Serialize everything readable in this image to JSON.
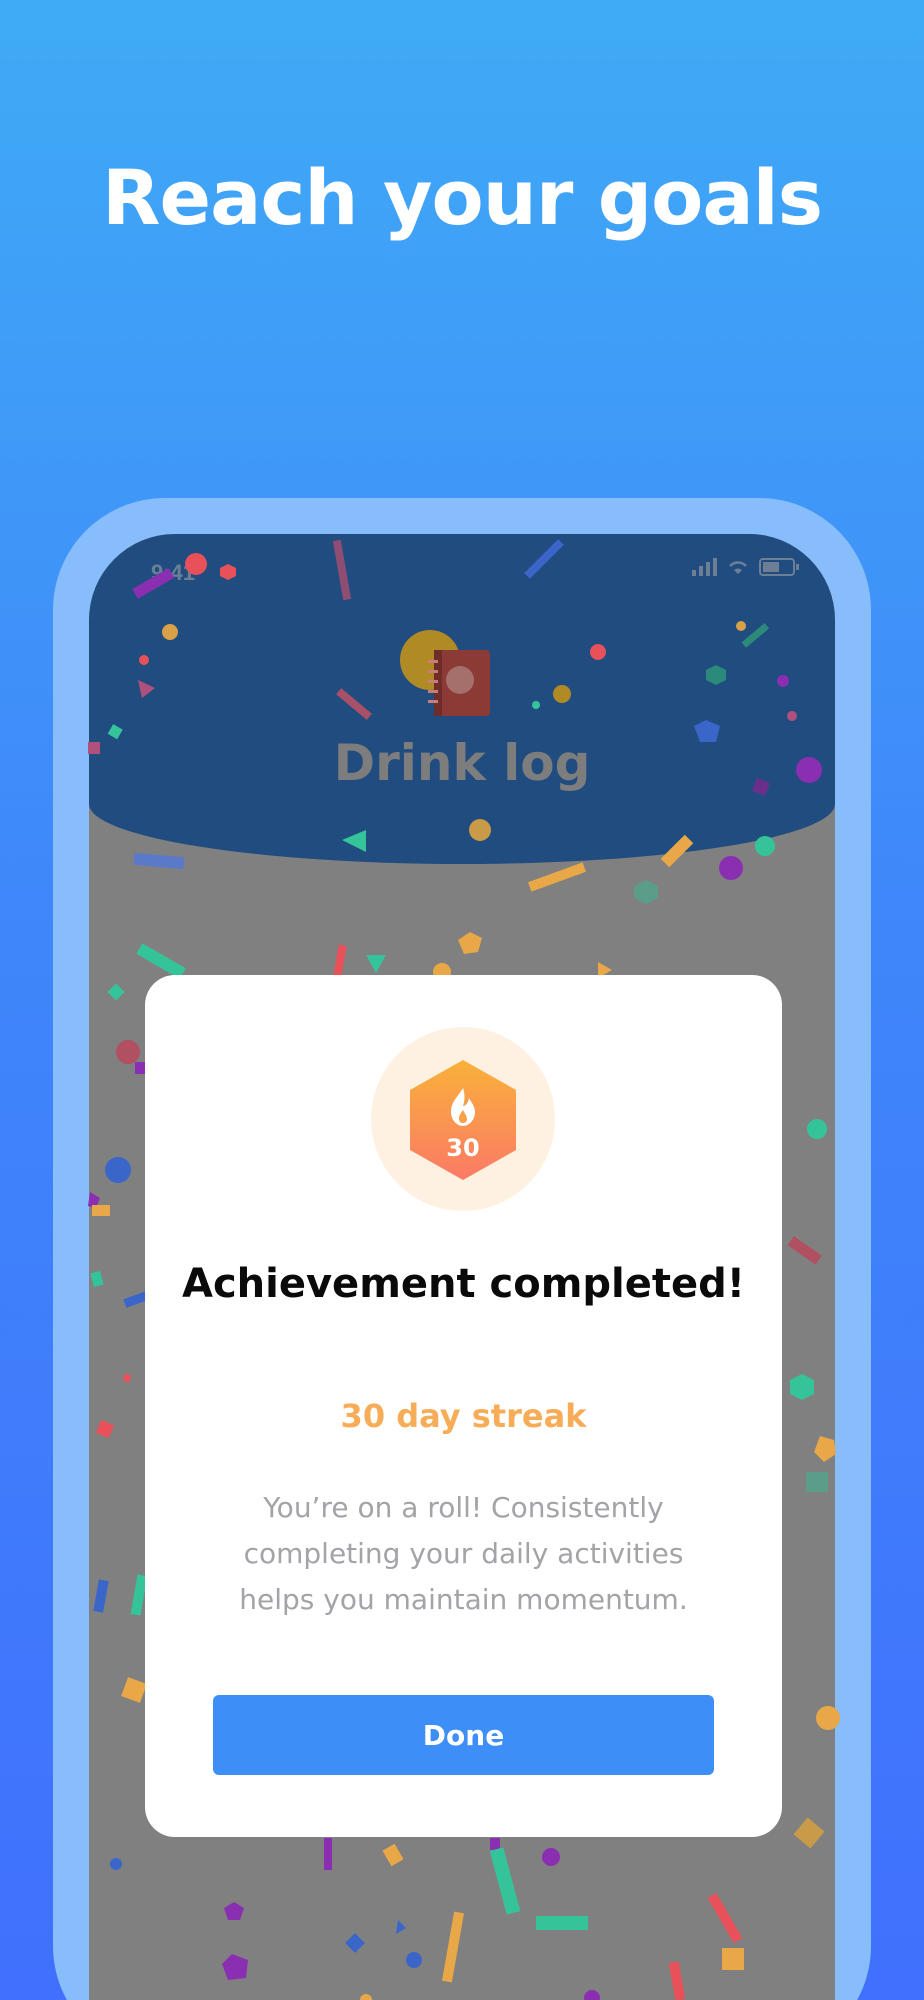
{
  "headline": "Reach your goals",
  "status_bar": {
    "time": "9:41"
  },
  "app": {
    "title": "Drink log"
  },
  "achievement": {
    "badge_number": "30",
    "badge_icon": "flame-icon",
    "title": "Achievement completed!",
    "subtitle": "30 day streak",
    "description": "You’re on a roll! Consistently completing your daily activities helps you maintain momentum.",
    "done_label": "Done"
  },
  "colors": {
    "background_top": "#3fabf6",
    "background_bottom": "#4070fd",
    "phone_frame": "#87bdfa",
    "header": "#214c80",
    "overlay": "#808080",
    "accent_orange": "#f7ad57",
    "button": "#3e8ef8"
  }
}
